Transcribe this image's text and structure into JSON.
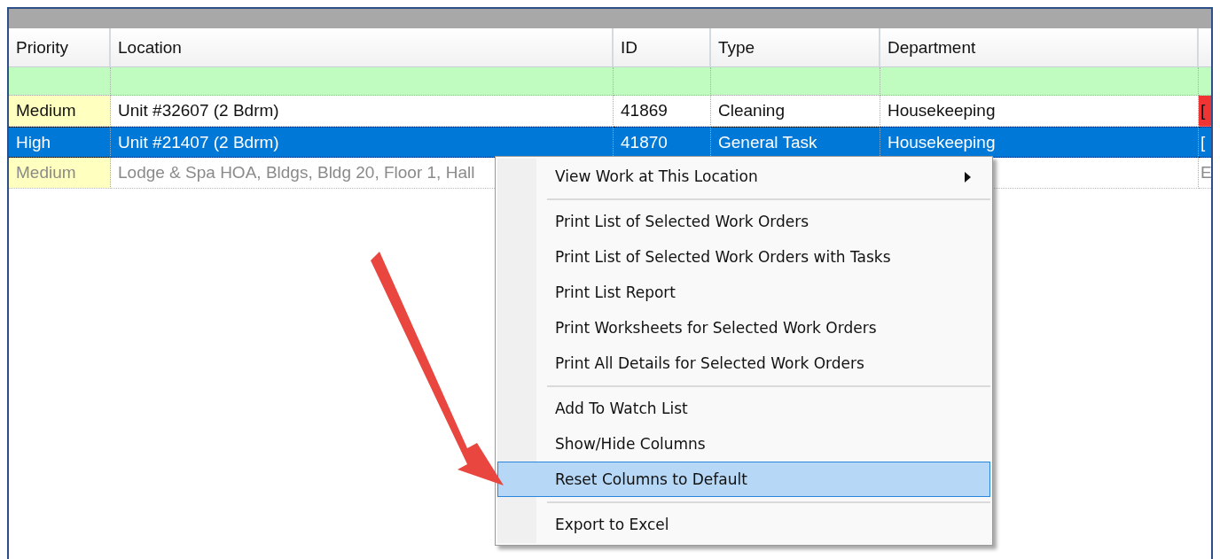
{
  "table": {
    "columns": [
      "Priority",
      "Location",
      "ID",
      "Type",
      "Department"
    ],
    "filter_row": {
      "active": true
    },
    "rows": [
      {
        "selected": false,
        "dimmed": false,
        "cells": [
          {
            "text": "Medium",
            "color": "#ffffc0"
          },
          {
            "text": "Unit #32607 (2 Bdrm)"
          },
          {
            "text": "41869"
          },
          {
            "text": "Cleaning"
          },
          {
            "text": "Housekeeping"
          },
          {
            "text": "[",
            "color": "#f03434"
          }
        ]
      },
      {
        "selected": true,
        "dimmed": false,
        "cells": [
          {
            "text": "High"
          },
          {
            "text": "Unit #21407 (2 Bdrm)"
          },
          {
            "text": "41870"
          },
          {
            "text": "General Task"
          },
          {
            "text": "Housekeeping"
          },
          {
            "text": "["
          }
        ]
      },
      {
        "selected": false,
        "dimmed": true,
        "cells": [
          {
            "text": "Medium",
            "color": "#ffffc0"
          },
          {
            "text": "Lodge & Spa HOA, Bldgs, Bldg 20, Floor 1, Hall"
          },
          {},
          {},
          {},
          {
            "text": "E"
          }
        ]
      }
    ]
  },
  "context_menu": {
    "items": [
      {
        "kind": "submenu",
        "label": "View Work at This Location",
        "selected": false
      },
      {
        "kind": "separator"
      },
      {
        "kind": "item",
        "label": "Print List of Selected Work Orders",
        "selected": false
      },
      {
        "kind": "item",
        "label": "Print List of Selected Work Orders with Tasks",
        "selected": false
      },
      {
        "kind": "item",
        "label": "Print List Report",
        "selected": false
      },
      {
        "kind": "item",
        "label": "Print Worksheets for Selected Work Orders",
        "selected": false
      },
      {
        "kind": "item",
        "label": "Print All Details for Selected Work Orders",
        "selected": false
      },
      {
        "kind": "separator"
      },
      {
        "kind": "item",
        "label": "Add To Watch List",
        "selected": false
      },
      {
        "kind": "item",
        "label": "Show/Hide Columns",
        "selected": false
      },
      {
        "kind": "item",
        "label": "Reset Columns to Default",
        "selected": true
      },
      {
        "kind": "separator"
      },
      {
        "kind": "item",
        "label": "Export to Excel",
        "selected": false
      }
    ]
  }
}
